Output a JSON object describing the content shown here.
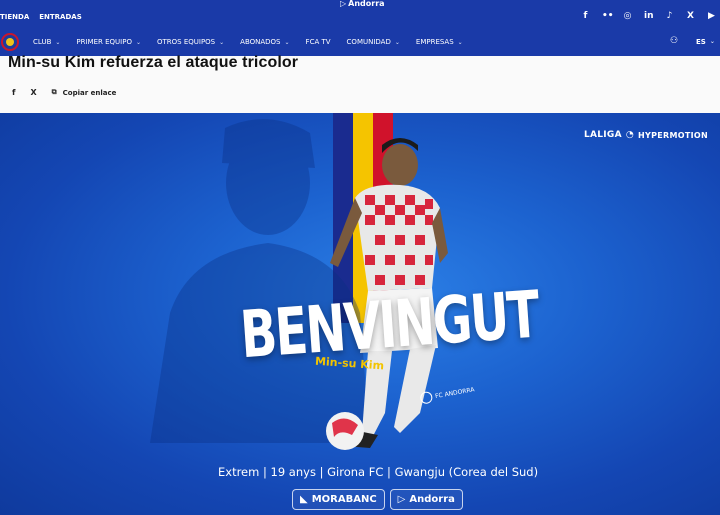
{
  "topbar": {
    "links": [
      "TIENDA",
      "ENTRADAS"
    ],
    "sponsor": "Andorra",
    "socials": [
      "facebook-icon",
      "flickr-icon",
      "instagram-icon",
      "linkedin-icon",
      "tiktok-icon",
      "x-icon",
      "youtube-icon"
    ]
  },
  "nav": {
    "items": [
      "CLUB",
      "PRIMER EQUIPO",
      "OTROS EQUIPOS",
      "ABONADOS",
      "FCA TV",
      "COMUNIDAD",
      "EMPRESAS"
    ],
    "has_chevron": [
      true,
      true,
      true,
      true,
      false,
      true,
      true
    ],
    "lang": "ES"
  },
  "article": {
    "title": "Min-su Kim refuerza el ataque tricolor",
    "copy_link": "Copiar enlace"
  },
  "hero": {
    "league": "LALIGA",
    "league_sub": "HYPERMOTION",
    "headline": "BENVINGUT",
    "player": "Min-su Kim",
    "club_mark": "FC ANDORRA",
    "info": "Extrem | 19 anys | Girona FC | Gwangju (Corea del Sud)",
    "sponsor_1": "MORABANC",
    "sponsor_2": "Andorra",
    "colors": {
      "stripe_blue": "#1a2b8f",
      "stripe_yellow": "#f5c400",
      "stripe_red": "#d0122b"
    }
  }
}
